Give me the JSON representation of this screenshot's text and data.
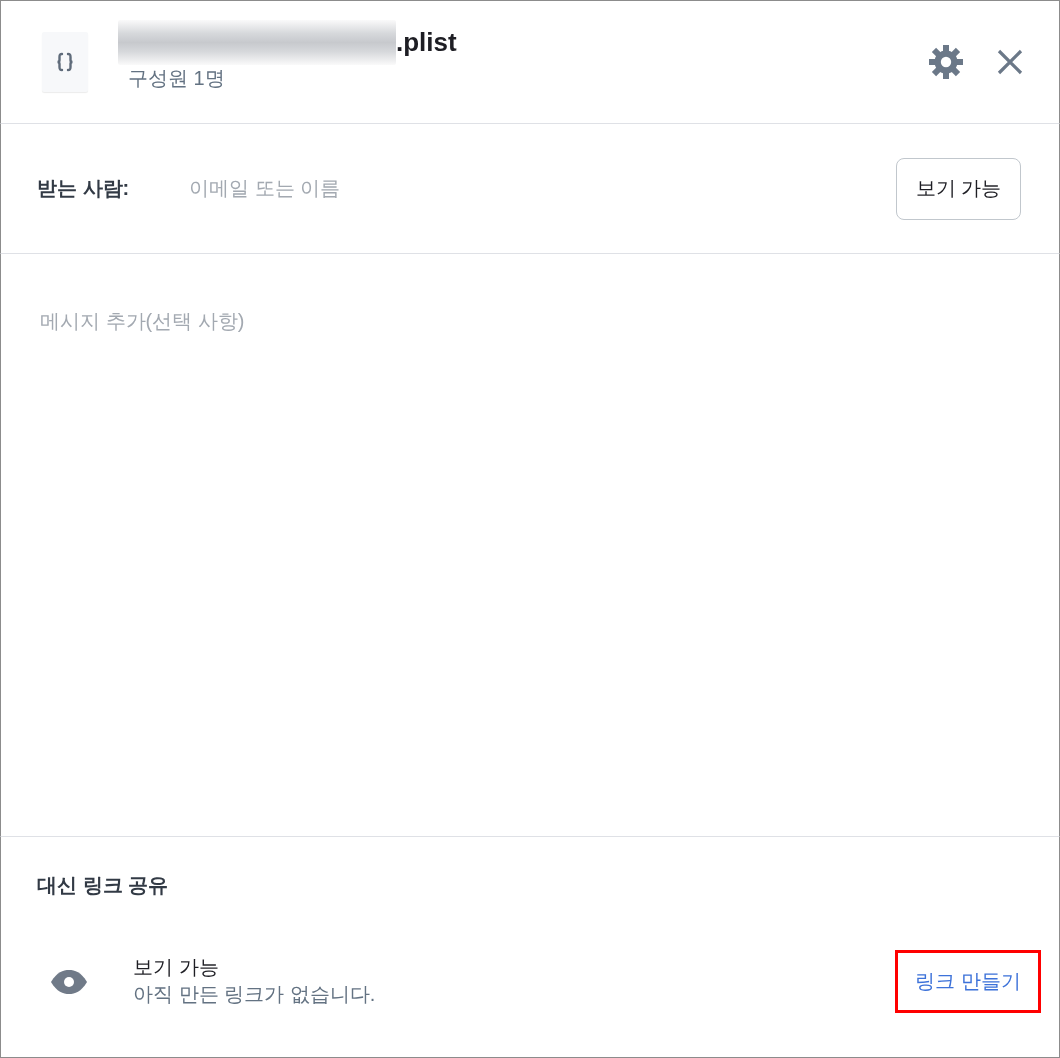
{
  "file": {
    "redacted": true,
    "title": ".plist",
    "subtitle": "구성원 1명"
  },
  "recipients": {
    "label": "받는 사람:",
    "placeholder": "이메일 또는 이름",
    "permission_button": "보기 가능"
  },
  "message": {
    "placeholder": "메시지 추가(선택 사항)"
  },
  "link_share": {
    "heading": "대신 링크 공유",
    "access": "보기 가능",
    "status": "아직 만든 링크가 없습니다.",
    "create_link": "링크 만들기",
    "highlighted": true
  }
}
